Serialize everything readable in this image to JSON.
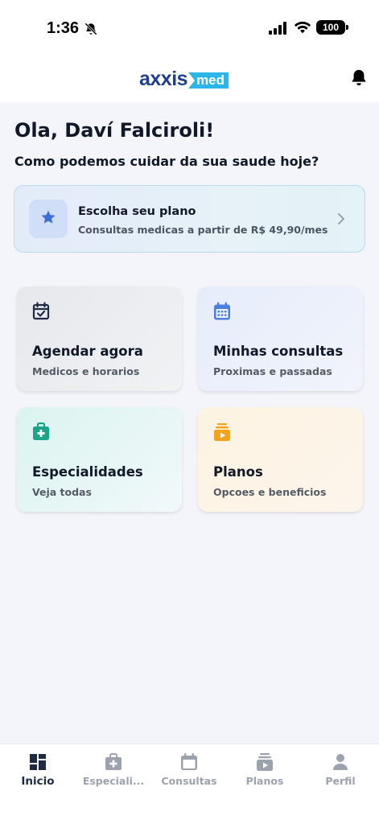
{
  "status_bar": {
    "time": "1:36",
    "battery": "100"
  },
  "header": {
    "logo_main": "axxis",
    "logo_sub": "med"
  },
  "greeting": "Ola, Daví Falciroli!",
  "subheading": "Como podemos cuidar da sua saude hoje?",
  "plan_banner": {
    "title": "Escolha seu plano",
    "description": "Consultas medicas a partir de R$ 49,90/mes"
  },
  "cards": [
    {
      "title": "Agendar agora",
      "subtitle": "Medicos e horarios",
      "icon": "calendar-check-icon",
      "icon_color": "#1f2a44"
    },
    {
      "title": "Minhas consultas",
      "subtitle": "Proximas e passadas",
      "icon": "calendar-grid-icon",
      "icon_color": "#4a7fe0"
    },
    {
      "title": "Especialidades",
      "subtitle": "Veja todas",
      "icon": "medical-bag-icon",
      "icon_color": "#1aa58a"
    },
    {
      "title": "Planos",
      "subtitle": "Opcoes e beneficios",
      "icon": "plan-stack-icon",
      "icon_color": "#f2a31b"
    }
  ],
  "tabs": [
    {
      "label": "Inicio",
      "icon": "grid-icon",
      "active": true
    },
    {
      "label": "Especiali...",
      "icon": "medical-bag-icon",
      "active": false
    },
    {
      "label": "Consultas",
      "icon": "calendar-icon",
      "active": false
    },
    {
      "label": "Planos",
      "icon": "play-stack-icon",
      "active": false
    },
    {
      "label": "Perfil",
      "icon": "person-icon",
      "active": false
    }
  ],
  "colors": {
    "background": "#f3f5fa",
    "brand_blue": "#1e3f8f",
    "brand_cyan": "#2bb5e8",
    "tab_active": "#1f2a44",
    "tab_inactive": "#9ca3af"
  }
}
